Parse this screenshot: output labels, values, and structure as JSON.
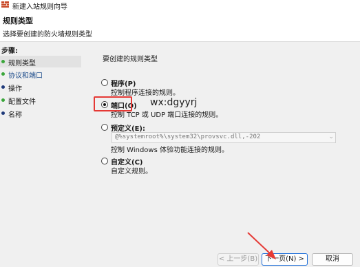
{
  "window": {
    "title": "新建入站规则向导"
  },
  "header": {
    "title": "规则类型",
    "subtitle": "选择要创建的防火墙规则类型"
  },
  "steps": {
    "heading": "步骤:",
    "items": [
      {
        "label": "规则类型",
        "dot_color": "#3aa63a"
      },
      {
        "label": "协议和端口",
        "dot_color": "#3aa63a"
      },
      {
        "label": "操作",
        "dot_color": "#1f3a7a"
      },
      {
        "label": "配置文件",
        "dot_color": "#3aa63a"
      },
      {
        "label": "名称",
        "dot_color": "#1f3a7a"
      }
    ]
  },
  "main": {
    "prompt": "要创建的规则类型",
    "options": [
      {
        "label": "程序(P)",
        "desc": "控制程序连接的规则。",
        "selected": false
      },
      {
        "label": "端口(O)",
        "desc": "控制 TCP 或 UDP 端口连接的规则。",
        "selected": true
      },
      {
        "label": "预定义(E):",
        "desc": "控制 Windows 体验功能连接的规则。",
        "selected": false
      },
      {
        "label": "自定义(C)",
        "desc": "自定义规则。",
        "selected": false
      }
    ],
    "predefined_dropdown": {
      "value": "@%systemroot%\\system32\\provsvc.dll,-202"
    }
  },
  "watermark": "wx:dgyyrj",
  "buttons": {
    "back": "< 上一步(B)",
    "next": "下一页(N) >",
    "cancel": "取消"
  },
  "colors": {
    "highlight": "#e53935",
    "primary_border": "#1e6fd9"
  }
}
